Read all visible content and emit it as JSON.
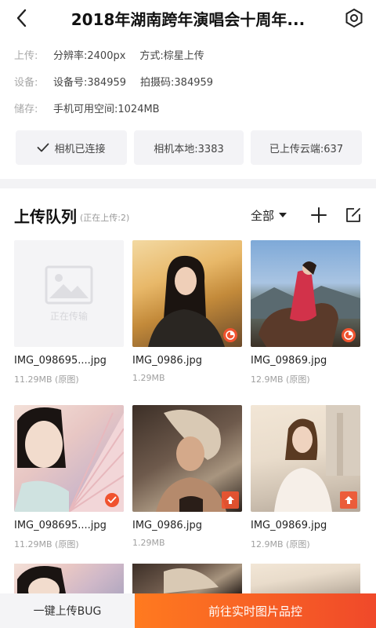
{
  "nav": {
    "title": "2018年湖南跨年演唱会十周年..."
  },
  "info": {
    "upload_label": "上传:",
    "resolution": "分辨率:2400px",
    "mode": "方式:棕星上传",
    "device_label": "设备:",
    "device_no": "设备号:384959",
    "shoot_code": "拍摄码:384959",
    "storage_label": "储存:",
    "storage": "手机可用空间:1024MB"
  },
  "status": {
    "camera": "相机已连接",
    "local": "相机本地:3383",
    "uploaded": "已上传云端:637"
  },
  "queue": {
    "title": "上传队列",
    "subtitle": "(正在上传:2)",
    "filter": "全部",
    "placeholder_text": "正在传输",
    "items": [
      {
        "name": "IMG_098695....jpg",
        "size": "11.29MB (原图)"
      },
      {
        "name": "IMG_0986.jpg",
        "size": "1.29MB"
      },
      {
        "name": "IMG_09869.jpg",
        "size": "12.9MB (原图)"
      },
      {
        "name": "IMG_098695....jpg",
        "size": "11.29MB (原图)"
      },
      {
        "name": "IMG_0986.jpg",
        "size": "1.29MB"
      },
      {
        "name": "IMG_09869.jpg",
        "size": "12.9MB (原图)"
      }
    ]
  },
  "bottom": {
    "left": "一键上传BUG",
    "right": "前往实时图片品控"
  },
  "colors": {
    "accent": "#f0532f",
    "gradient_start": "#ff7a1f",
    "gradient_end": "#f0492a"
  }
}
